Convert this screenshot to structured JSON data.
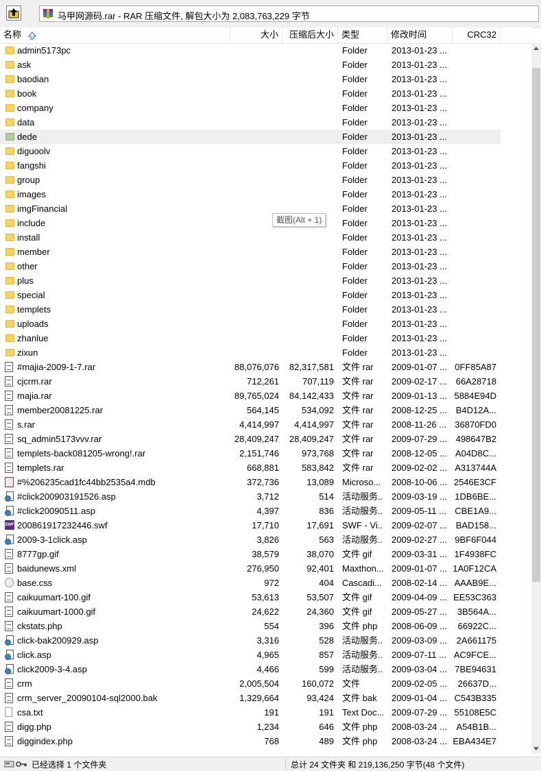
{
  "toolbar": {
    "up_icon": "up-folder-icon",
    "path_icon": "winrar-archive-icon",
    "path_text": "马甲网源码.rar - RAR 压缩文件, 解包大小为 2,083,763,229 字节"
  },
  "columns": {
    "name": "名称",
    "size": "大小",
    "packed": "压缩后大小",
    "type": "类型",
    "modified": "修改时间",
    "crc": "CRC32"
  },
  "rows": [
    {
      "icon": "folder",
      "name": "admin5173pc",
      "size": "",
      "packed": "",
      "type": "Folder",
      "date": "2013-01-23 ...",
      "crc": ""
    },
    {
      "icon": "folder",
      "name": "ask",
      "size": "",
      "packed": "",
      "type": "Folder",
      "date": "2013-01-23 ...",
      "crc": ""
    },
    {
      "icon": "folder",
      "name": "baodian",
      "size": "",
      "packed": "",
      "type": "Folder",
      "date": "2013-01-23 ...",
      "crc": ""
    },
    {
      "icon": "folder",
      "name": "book",
      "size": "",
      "packed": "",
      "type": "Folder",
      "date": "2013-01-23 ...",
      "crc": ""
    },
    {
      "icon": "folder",
      "name": "company",
      "size": "",
      "packed": "",
      "type": "Folder",
      "date": "2013-01-23 ...",
      "crc": ""
    },
    {
      "icon": "folder",
      "name": "data",
      "size": "",
      "packed": "",
      "type": "Folder",
      "date": "2013-01-23 ...",
      "crc": ""
    },
    {
      "icon": "folder-dim",
      "name": "dede",
      "size": "",
      "packed": "",
      "type": "Folder",
      "date": "2013-01-23 ...",
      "crc": "",
      "selected": true
    },
    {
      "icon": "folder",
      "name": "diguoolv",
      "size": "",
      "packed": "",
      "type": "Folder",
      "date": "2013-01-23 ...",
      "crc": ""
    },
    {
      "icon": "folder",
      "name": "fangshi",
      "size": "",
      "packed": "",
      "type": "Folder",
      "date": "2013-01-23 ...",
      "crc": ""
    },
    {
      "icon": "folder",
      "name": "group",
      "size": "",
      "packed": "",
      "type": "Folder",
      "date": "2013-01-23 ...",
      "crc": ""
    },
    {
      "icon": "folder",
      "name": "images",
      "size": "",
      "packed": "",
      "type": "Folder",
      "date": "2013-01-23 ...",
      "crc": ""
    },
    {
      "icon": "folder",
      "name": "imgFinancial",
      "size": "",
      "packed": "",
      "type": "Folder",
      "date": "2013-01-23 ...",
      "crc": ""
    },
    {
      "icon": "folder",
      "name": "include",
      "size": "",
      "packed": "",
      "type": "Folder",
      "date": "2013-01-23 ...",
      "crc": ""
    },
    {
      "icon": "folder",
      "name": "install",
      "size": "",
      "packed": "",
      "type": "Folder",
      "date": "2013-01-23 ...",
      "crc": ""
    },
    {
      "icon": "folder",
      "name": "member",
      "size": "",
      "packed": "",
      "type": "Folder",
      "date": "2013-01-23 ...",
      "crc": ""
    },
    {
      "icon": "folder",
      "name": "other",
      "size": "",
      "packed": "",
      "type": "Folder",
      "date": "2013-01-23 ...",
      "crc": ""
    },
    {
      "icon": "folder",
      "name": "plus",
      "size": "",
      "packed": "",
      "type": "Folder",
      "date": "2013-01-23 ...",
      "crc": ""
    },
    {
      "icon": "folder",
      "name": "special",
      "size": "",
      "packed": "",
      "type": "Folder",
      "date": "2013-01-23 ...",
      "crc": ""
    },
    {
      "icon": "folder",
      "name": "templets",
      "size": "",
      "packed": "",
      "type": "Folder",
      "date": "2013-01-23 ...",
      "crc": ""
    },
    {
      "icon": "folder",
      "name": "uploads",
      "size": "",
      "packed": "",
      "type": "Folder",
      "date": "2013-01-23 ...",
      "crc": ""
    },
    {
      "icon": "folder",
      "name": "zhanlue",
      "size": "",
      "packed": "",
      "type": "Folder",
      "date": "2013-01-23 ...",
      "crc": ""
    },
    {
      "icon": "folder",
      "name": "zixun",
      "size": "",
      "packed": "",
      "type": "Folder",
      "date": "2013-01-23 ...",
      "crc": ""
    },
    {
      "icon": "file",
      "name": "#majia-2009-1-7.rar",
      "size": "88,076,076",
      "packed": "82,317,581",
      "type": "文件 rar",
      "date": "2009-01-07 ...",
      "crc": "0FF85A87"
    },
    {
      "icon": "file",
      "name": "cjcrm.rar",
      "size": "712,261",
      "packed": "707,119",
      "type": "文件 rar",
      "date": "2009-02-17 ...",
      "crc": "66A28718"
    },
    {
      "icon": "file",
      "name": "majia.rar",
      "size": "89,765,024",
      "packed": "84,142,433",
      "type": "文件 rar",
      "date": "2009-01-13 ...",
      "crc": "5884E94D"
    },
    {
      "icon": "file",
      "name": "member20081225.rar",
      "size": "564,145",
      "packed": "534,092",
      "type": "文件 rar",
      "date": "2008-12-25 ...",
      "crc": "B4D12A..."
    },
    {
      "icon": "file",
      "name": "s.rar",
      "size": "4,414,997",
      "packed": "4,414,997",
      "type": "文件 rar",
      "date": "2008-11-26 ...",
      "crc": "36870FD0"
    },
    {
      "icon": "file",
      "name": "sq_admin5173vvv.rar",
      "size": "28,409,247",
      "packed": "28,409,247",
      "type": "文件 rar",
      "date": "2009-07-29 ...",
      "crc": "498647B2"
    },
    {
      "icon": "file",
      "name": "templets-back081205-wrong!.rar",
      "size": "2,151,746",
      "packed": "973,768",
      "type": "文件 rar",
      "date": "2008-12-05 ...",
      "crc": "A04D8C..."
    },
    {
      "icon": "file",
      "name": "templets.rar",
      "size": "668,881",
      "packed": "583,842",
      "type": "文件 rar",
      "date": "2009-02-02 ...",
      "crc": "A313744A"
    },
    {
      "icon": "mdb",
      "name": "#%206235cad1fc44bb2535a4.mdb",
      "size": "372,736",
      "packed": "13,089",
      "type": "Microso...",
      "date": "2008-10-06 ...",
      "crc": "2546E3CF"
    },
    {
      "icon": "web",
      "name": "#click200903191526.asp",
      "size": "3,712",
      "packed": "514",
      "type": "活动服务...",
      "date": "2009-03-19 ...",
      "crc": "1DB6BE..."
    },
    {
      "icon": "web",
      "name": "#click20090511.asp",
      "size": "4,397",
      "packed": "836",
      "type": "活动服务...",
      "date": "2009-05-11 ...",
      "crc": "CBE1A9..."
    },
    {
      "icon": "swf",
      "name": "200861917232446.swf",
      "size": "17,710",
      "packed": "17,691",
      "type": "SWF - Vi...",
      "date": "2009-02-07 ...",
      "crc": "BAD158..."
    },
    {
      "icon": "web",
      "name": "2009-3-1click.asp",
      "size": "3,826",
      "packed": "563",
      "type": "活动服务...",
      "date": "2009-02-27 ...",
      "crc": "9BF6F044"
    },
    {
      "icon": "file",
      "name": "8777gp.gif",
      "size": "38,579",
      "packed": "38,070",
      "type": "文件 gif",
      "date": "2009-03-31 ...",
      "crc": "1F4938FC"
    },
    {
      "icon": "file",
      "name": "baidunews.xml",
      "size": "276,950",
      "packed": "92,401",
      "type": "Maxthon...",
      "date": "2009-01-07 ...",
      "crc": "1A0F12CA"
    },
    {
      "icon": "css",
      "name": "base.css",
      "size": "972",
      "packed": "404",
      "type": "Cascadi...",
      "date": "2008-02-14 ...",
      "crc": "AAAB9E..."
    },
    {
      "icon": "file",
      "name": "caikuumart-100.gif",
      "size": "53,613",
      "packed": "53,507",
      "type": "文件 gif",
      "date": "2009-04-09 ...",
      "crc": "EE53C363"
    },
    {
      "icon": "file",
      "name": "caikuumart-1000.gif",
      "size": "24,622",
      "packed": "24,360",
      "type": "文件 gif",
      "date": "2009-05-27 ...",
      "crc": "3B564A..."
    },
    {
      "icon": "file",
      "name": "ckstats.php",
      "size": "554",
      "packed": "396",
      "type": "文件 php",
      "date": "2008-06-09 ...",
      "crc": "66922C..."
    },
    {
      "icon": "web",
      "name": "click-bak200929.asp",
      "size": "3,316",
      "packed": "528",
      "type": "活动服务...",
      "date": "2009-03-09 ...",
      "crc": "2A661175"
    },
    {
      "icon": "web",
      "name": "click.asp",
      "size": "4,965",
      "packed": "857",
      "type": "活动服务...",
      "date": "2009-07-11 ...",
      "crc": "AC9FCE..."
    },
    {
      "icon": "web",
      "name": "click2009-3-4.asp",
      "size": "4,466",
      "packed": "599",
      "type": "活动服务...",
      "date": "2009-03-04 ...",
      "crc": "7BE94631"
    },
    {
      "icon": "file",
      "name": "crm",
      "size": "2,005,504",
      "packed": "160,072",
      "type": "文件",
      "date": "2009-02-05 ...",
      "crc": "26637D..."
    },
    {
      "icon": "file",
      "name": "crm_server_20090104-sql2000.bak",
      "size": "1,329,664",
      "packed": "93,424",
      "type": "文件 bak",
      "date": "2009-01-04 ...",
      "crc": "C543B335"
    },
    {
      "icon": "txt",
      "name": "csa.txt",
      "size": "191",
      "packed": "191",
      "type": "Text Doc...",
      "date": "2009-07-29 ...",
      "crc": "55108E5C"
    },
    {
      "icon": "file",
      "name": "digg.php",
      "size": "1,234",
      "packed": "646",
      "type": "文件 php",
      "date": "2008-03-24 ...",
      "crc": "A54B1B..."
    },
    {
      "icon": "file",
      "name": "diggindex.php",
      "size": "768",
      "packed": "489",
      "type": "文件 php",
      "date": "2008-03-24 ...",
      "crc": "EBA434E7"
    }
  ],
  "tooltip": "截图(Alt + 1)",
  "status": {
    "icons": "drive-key-icons",
    "left": "已经选择 1 个文件夹",
    "right": "总计 24 文件夹 和 219,136,250 字节(48 个文件)"
  }
}
